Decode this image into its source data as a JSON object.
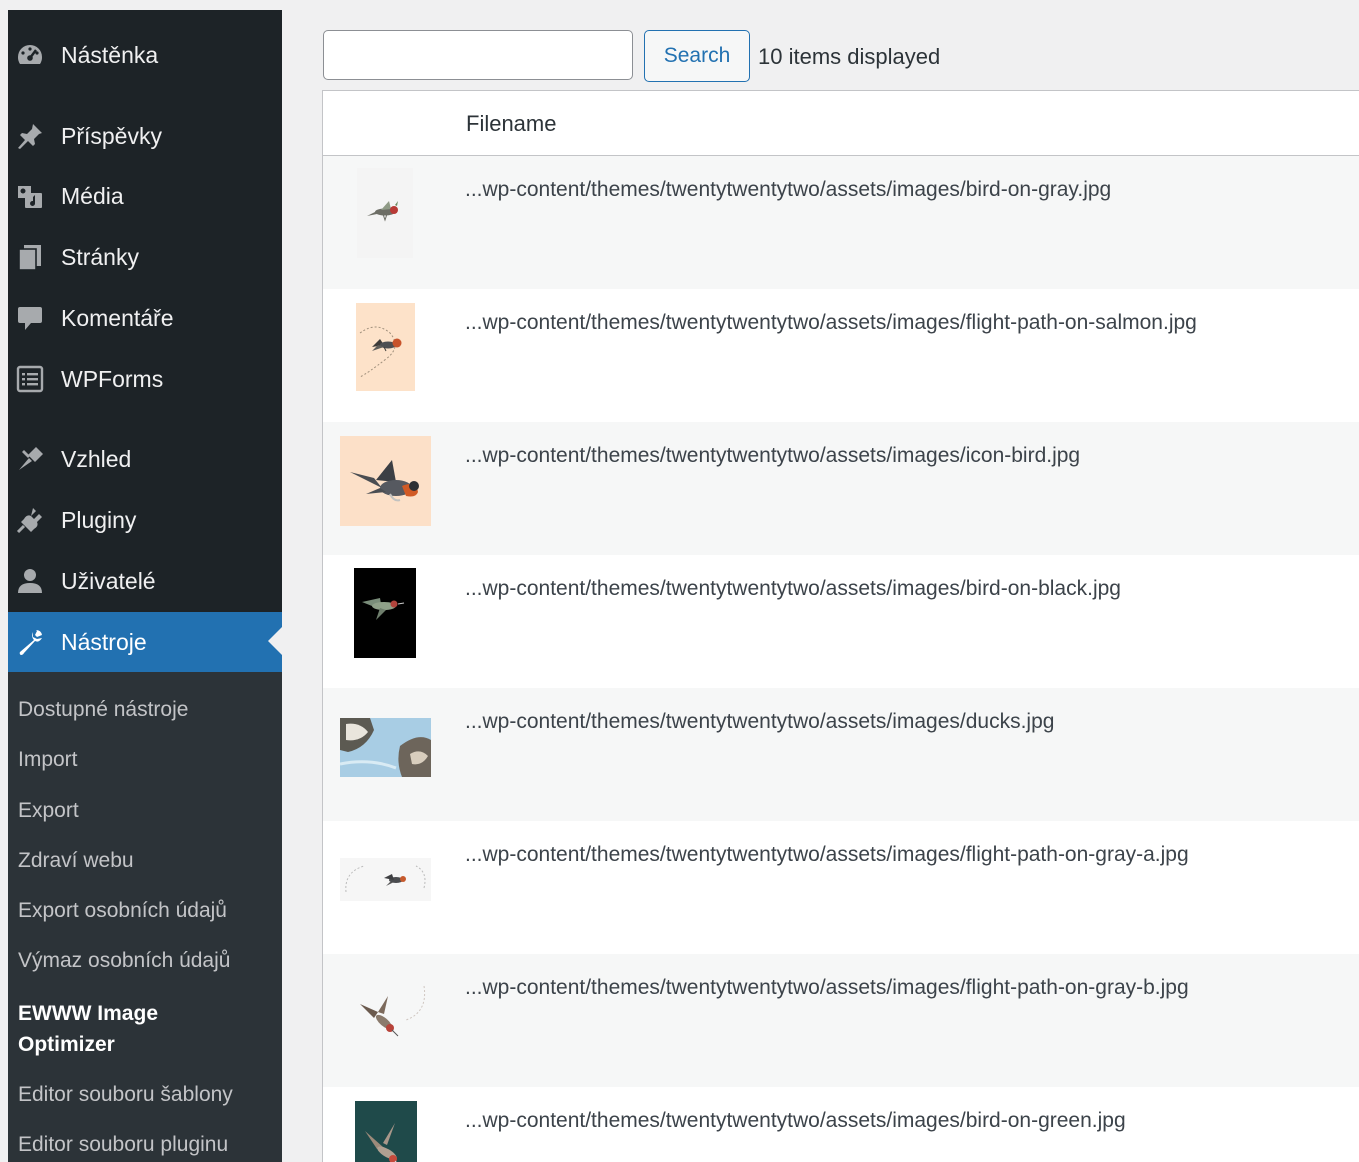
{
  "sidebar": {
    "items": [
      {
        "label": "Nástěnka",
        "icon": "dashboard-icon"
      },
      {
        "label": "Příspěvky",
        "icon": "pin-icon"
      },
      {
        "label": "Média",
        "icon": "media-icon"
      },
      {
        "label": "Stránky",
        "icon": "pages-icon"
      },
      {
        "label": "Komentáře",
        "icon": "comment-icon"
      },
      {
        "label": "WPForms",
        "icon": "forms-icon"
      },
      {
        "label": "Vzhled",
        "icon": "appearance-icon"
      },
      {
        "label": "Pluginy",
        "icon": "plugin-icon"
      },
      {
        "label": "Uživatelé",
        "icon": "user-icon"
      },
      {
        "label": "Nástroje",
        "icon": "wrench-icon"
      }
    ],
    "submenu": [
      "Dostupné nástroje",
      "Import",
      "Export",
      "Zdraví webu",
      "Export osobních údajů",
      "Výmaz osobních údajů",
      "EWWW Image Optimizer",
      "Editor souboru šablony",
      "Editor souboru pluginu"
    ]
  },
  "search": {
    "value": "",
    "button_label": "Search",
    "items_count": "10 items displayed"
  },
  "table": {
    "header_filename": "Filename",
    "rows": [
      {
        "filename": "...wp-content/themes/twentytwentytwo/assets/images/bird-on-gray.jpg",
        "thumb": "bird-on-gray"
      },
      {
        "filename": "...wp-content/themes/twentytwentytwo/assets/images/flight-path-on-salmon.jpg",
        "thumb": "flight-path-on-salmon"
      },
      {
        "filename": "...wp-content/themes/twentytwentytwo/assets/images/icon-bird.jpg",
        "thumb": "icon-bird"
      },
      {
        "filename": "...wp-content/themes/twentytwentytwo/assets/images/bird-on-black.jpg",
        "thumb": "bird-on-black"
      },
      {
        "filename": "...wp-content/themes/twentytwentytwo/assets/images/ducks.jpg",
        "thumb": "ducks"
      },
      {
        "filename": "...wp-content/themes/twentytwentytwo/assets/images/flight-path-on-gray-a.jpg",
        "thumb": "flight-path-on-gray-a"
      },
      {
        "filename": "...wp-content/themes/twentytwentytwo/assets/images/flight-path-on-gray-b.jpg",
        "thumb": "flight-path-on-gray-b"
      },
      {
        "filename": "...wp-content/themes/twentytwentytwo/assets/images/bird-on-green.jpg",
        "thumb": "bird-on-green"
      }
    ]
  },
  "colors": {
    "sidebar_bg": "#1d2327",
    "submenu_bg": "#2c3338",
    "accent": "#2271b1",
    "page_bg": "#f0f0f1"
  }
}
